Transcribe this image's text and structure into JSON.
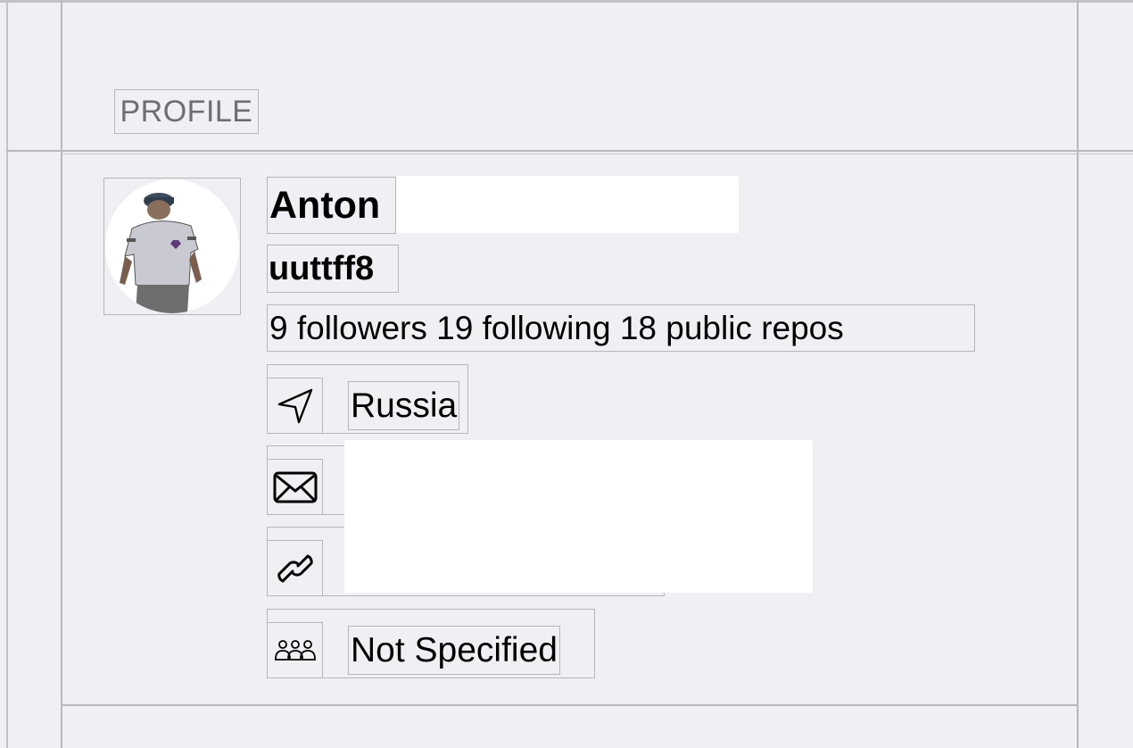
{
  "section": {
    "header": "PROFILE"
  },
  "profile": {
    "name": "Anton",
    "login": "uuttff8",
    "stats": "9 followers 19 following 18 public repos",
    "avatar_description_icon": "avatar-image",
    "details": [
      {
        "icon": "location-arrow-icon",
        "label": "Russia"
      },
      {
        "icon": "envelope-icon",
        "label": ""
      },
      {
        "icon": "link-icon",
        "label": ""
      },
      {
        "icon": "people-icon",
        "label": "Not Specified"
      }
    ]
  },
  "colors": {
    "background": "#efeff4",
    "separator": "#b8b8bd",
    "header_text": "#6d6d72",
    "redaction": "#ffffff"
  }
}
